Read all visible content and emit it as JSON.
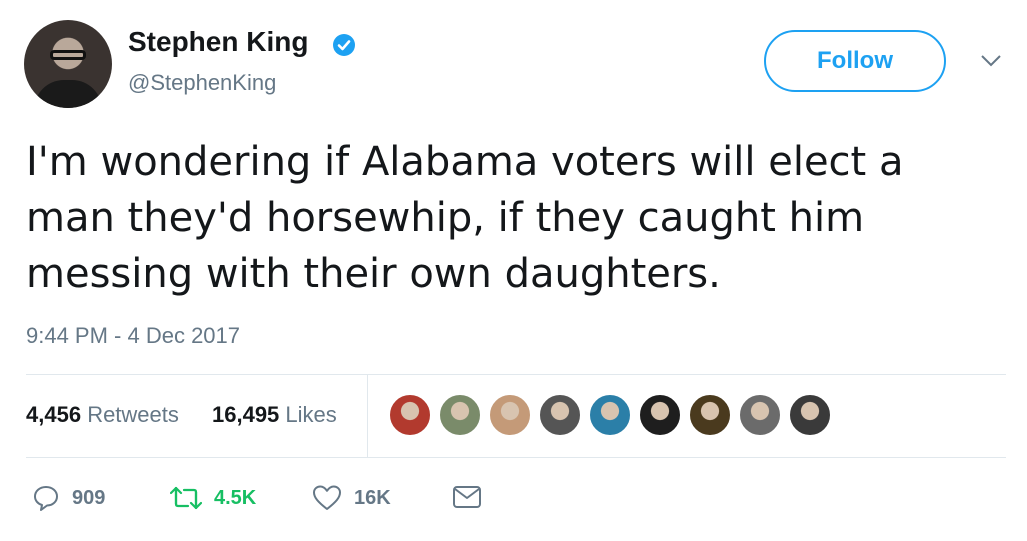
{
  "author": {
    "name": "Stephen King",
    "handle": "@StephenKing",
    "verified": true
  },
  "follow_button": {
    "label": "Follow"
  },
  "tweet": {
    "text": "I'm wondering if Alabama voters will elect a man they'd horsewhip, if they caught him messing with their own daughters.",
    "timestamp": "9:44 PM - 4 Dec 2017"
  },
  "stats": {
    "retweets_count": "4,456",
    "retweets_label": "Retweets",
    "likes_count": "16,495",
    "likes_label": "Likes"
  },
  "likers": [
    {
      "color": "#b23a2e"
    },
    {
      "color": "#7a8b6a"
    },
    {
      "color": "#c49a78"
    },
    {
      "color": "#555555"
    },
    {
      "color": "#2b7fa8"
    },
    {
      "color": "#1e1e1e"
    },
    {
      "color": "#4a3a1e"
    },
    {
      "color": "#6b6b6b"
    },
    {
      "color": "#3a3a3a"
    }
  ],
  "actions": {
    "reply_count": "909",
    "retweet_count": "4.5K",
    "like_count": "16K"
  },
  "colors": {
    "accent": "#1da1f2",
    "retweet": "#17bf63",
    "secondary_text": "#657786"
  }
}
